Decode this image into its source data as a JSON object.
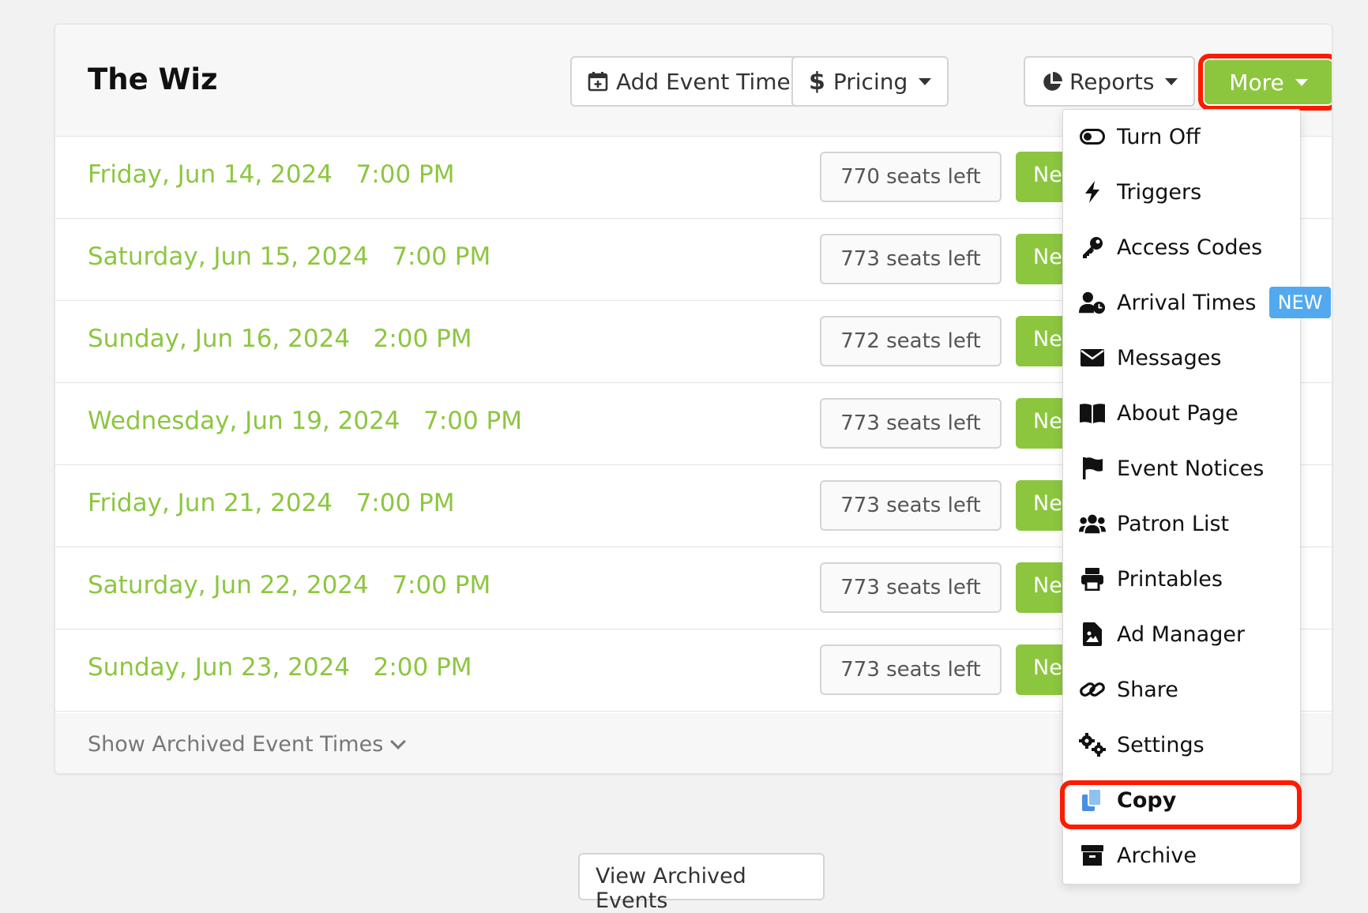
{
  "event": {
    "title": "The Wiz"
  },
  "toolbar": {
    "add_event_times_label": "Add Event Times",
    "pricing_label": "Pricing",
    "reports_label": "Reports",
    "more_label": "More"
  },
  "event_times": [
    {
      "date": "Friday, Jun 14, 2024",
      "time": "7:00 PM",
      "seats": "770 seats left",
      "action": "Ne"
    },
    {
      "date": "Saturday, Jun 15, 2024",
      "time": "7:00 PM",
      "seats": "773 seats left",
      "action": "Ne"
    },
    {
      "date": "Sunday, Jun 16, 2024",
      "time": "2:00 PM",
      "seats": "772 seats left",
      "action": "Ne"
    },
    {
      "date": "Wednesday, Jun 19, 2024",
      "time": "7:00 PM",
      "seats": "773 seats left",
      "action": "Ne"
    },
    {
      "date": "Friday, Jun 21, 2024",
      "time": "7:00 PM",
      "seats": "773 seats left",
      "action": "Ne"
    },
    {
      "date": "Saturday, Jun 22, 2024",
      "time": "7:00 PM",
      "seats": "773 seats left",
      "action": "Ne"
    },
    {
      "date": "Sunday, Jun 23, 2024",
      "time": "2:00 PM",
      "seats": "773 seats left",
      "action": "Ne"
    }
  ],
  "footer": {
    "show_archived_label": "Show Archived Event Times"
  },
  "view_archived_events_label": "View Archived Events",
  "more_menu": {
    "items": [
      {
        "label": "Turn Off",
        "icon": "toggle-icon"
      },
      {
        "label": "Triggers",
        "icon": "bolt-icon"
      },
      {
        "label": "Access Codes",
        "icon": "key-icon"
      },
      {
        "label": "Arrival Times",
        "icon": "user-clock-icon",
        "badge": "NEW"
      },
      {
        "label": "Messages",
        "icon": "envelope-icon"
      },
      {
        "label": "About Page",
        "icon": "book-icon"
      },
      {
        "label": "Event Notices",
        "icon": "flag-icon"
      },
      {
        "label": "Patron List",
        "icon": "users-icon"
      },
      {
        "label": "Printables",
        "icon": "printer-icon"
      },
      {
        "label": "Ad Manager",
        "icon": "file-image-icon"
      },
      {
        "label": "Share",
        "icon": "link-icon"
      },
      {
        "label": "Settings",
        "icon": "gears-icon"
      },
      {
        "label": "Copy",
        "icon": "copy-icon"
      },
      {
        "label": "Archive",
        "icon": "archive-icon"
      }
    ]
  },
  "colors": {
    "accent_green": "#8cc63f",
    "highlight_red": "#ff1a00",
    "badge_blue": "#52a9f0"
  }
}
